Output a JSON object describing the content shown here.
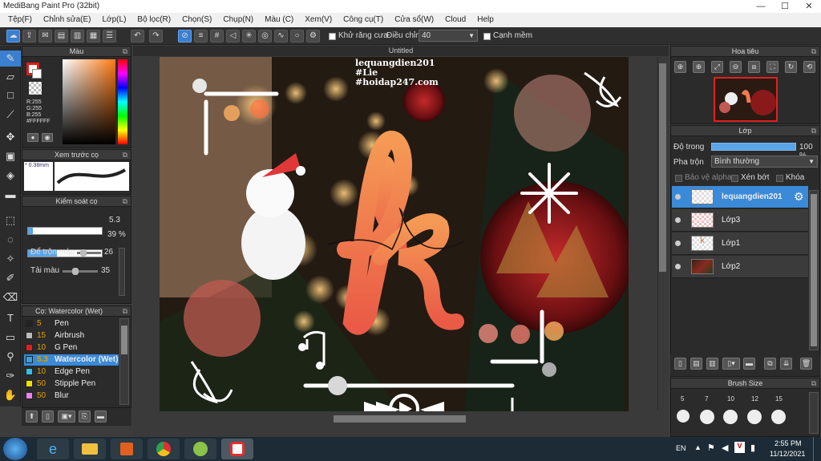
{
  "window": {
    "title": "MediBang Paint Pro (32bit)",
    "minimize": "—",
    "maximize": "☐",
    "close": "✕"
  },
  "menu": [
    "Tệp(F)",
    "Chỉnh sửa(E)",
    "Lớp(L)",
    "Bộ lọc(R)",
    "Chọn(S)",
    "Chụp(N)",
    "Màu (C)",
    "Xem(V)",
    "Công cụ(T)",
    "Cửa sổ(W)",
    "Cloud",
    "Help"
  ],
  "toolbar": {
    "antialias_label": "Khử răng cưa",
    "adjust_label": "Điều chỉnh",
    "adjust_value": "40",
    "sharp_edge_label": "Cạnh mềm"
  },
  "color_panel": {
    "title": "Màu",
    "r": "R:255",
    "g": "G:255",
    "b": "B:255",
    "hex": "#FFFFFF"
  },
  "brush_preview": {
    "title": "Xem trước cọ",
    "size": "0.38mm"
  },
  "brush_control": {
    "title": "Kiểm soát cọ",
    "size_value": "5.3",
    "opacity_value": "39 %",
    "opacity_fraction": 0.39,
    "blend_label": "Để trộn màu",
    "blend_value": "26",
    "reload_label": "Tải màu",
    "reload_value": "35"
  },
  "brush_list": {
    "title": "Cọ: Watercolor (Wet)",
    "items": [
      {
        "size": "5",
        "name": "Pen",
        "color": "#222222"
      },
      {
        "size": "15",
        "name": "Airbrush",
        "color": "#bbbbbb"
      },
      {
        "size": "10",
        "name": "G Pen",
        "color": "#e02020"
      },
      {
        "size": "5.3",
        "name": "Watercolor (Wet)",
        "color": "#3aa0e0"
      },
      {
        "size": "10",
        "name": "Edge Pen",
        "color": "#30c0e8"
      },
      {
        "size": "50",
        "name": "Stipple Pen",
        "color": "#f0e000"
      },
      {
        "size": "50",
        "name": "Blur",
        "color": "#f080f0"
      }
    ]
  },
  "canvas": {
    "tab_title": "Untitled",
    "watermark_1": "lequangdien201",
    "watermark_2": "#Lie",
    "watermark_3": "#hoidap247.com"
  },
  "navigator": {
    "title": "Hoa tiêu"
  },
  "layers_panel": {
    "title": "Lớp",
    "opacity_label": "Độ trong",
    "opacity_value": "100 %",
    "blend_label": "Pha trộn",
    "blend_value": "Bình thường",
    "protect_alpha": "Bảo vệ alpha",
    "clipping": "Xén bớt",
    "lock": "Khóa",
    "layers": [
      {
        "name": "lequangdien201",
        "selected": true
      },
      {
        "name": "Lớp3",
        "selected": false
      },
      {
        "name": "Lớp1",
        "selected": false
      },
      {
        "name": "Lớp2",
        "selected": false
      }
    ]
  },
  "brush_size": {
    "title": "Brush Size",
    "sizes": [
      "5",
      "7",
      "10",
      "12",
      "15"
    ]
  },
  "taskbar": {
    "lang": "EN",
    "time": "2:55 PM",
    "date": "11/12/2021"
  }
}
